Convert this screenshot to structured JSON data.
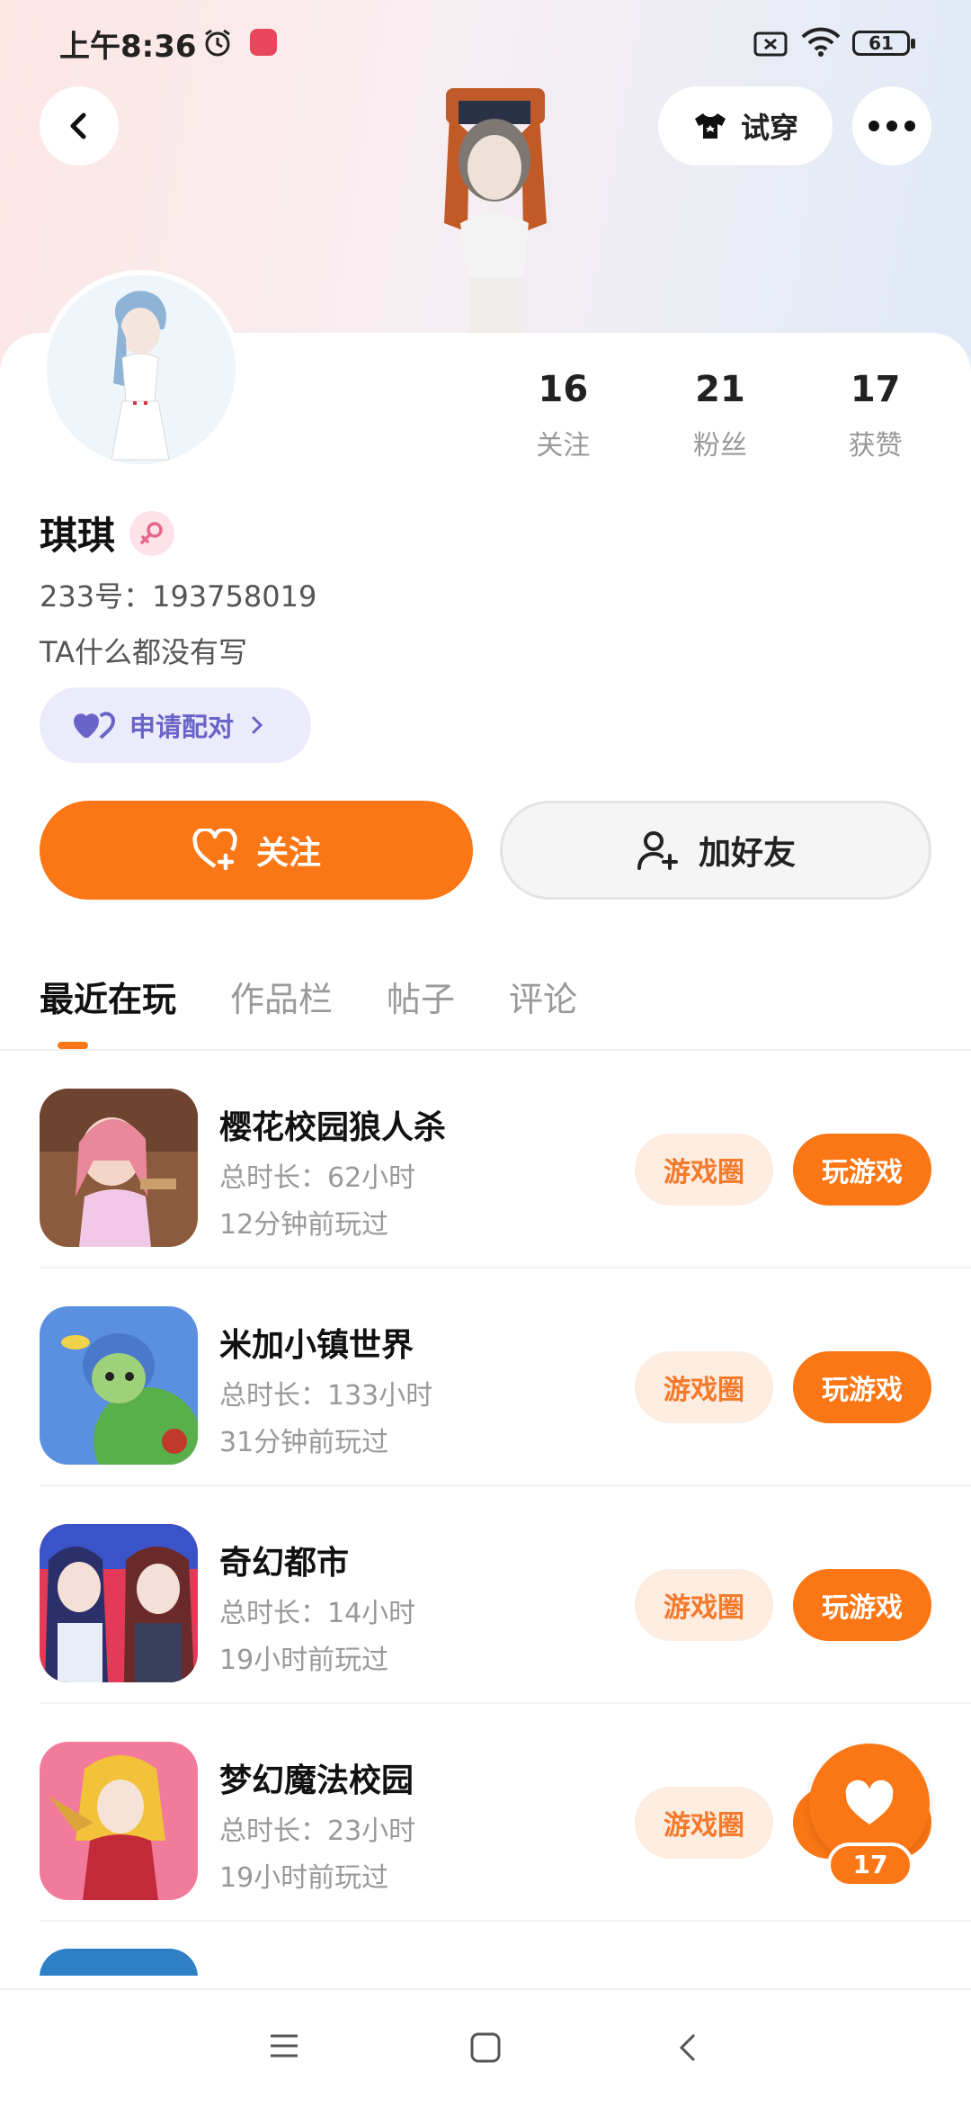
{
  "status_bar": {
    "time": "上午8:36",
    "battery": "61"
  },
  "header": {
    "tryon_label": "试穿"
  },
  "profile": {
    "name": "琪琪",
    "user_id": "233号：193758019",
    "bio": "TA什么都没有写",
    "stats": [
      {
        "value": "16",
        "label": "关注"
      },
      {
        "value": "21",
        "label": "粉丝"
      },
      {
        "value": "17",
        "label": "获赞"
      }
    ],
    "pair_label": "申请配对",
    "follow_label": "关注",
    "add_friend_label": "加好友"
  },
  "tabs": [
    {
      "label": "最近在玩",
      "active": true
    },
    {
      "label": "作品栏",
      "active": false
    },
    {
      "label": "帖子",
      "active": false
    },
    {
      "label": "评论",
      "active": false
    }
  ],
  "games": [
    {
      "name": "樱花校园狼人杀",
      "total_time": "总时长：62小时",
      "last_played": "12分钟前玩过",
      "circle_label": "游戏圈",
      "play_label": "玩游戏"
    },
    {
      "name": "米加小镇世界",
      "total_time": "总时长：133小时",
      "last_played": "31分钟前玩过",
      "circle_label": "游戏圈",
      "play_label": "玩游戏"
    },
    {
      "name": "奇幻都市",
      "total_time": "总时长：14小时",
      "last_played": "19小时前玩过",
      "circle_label": "游戏圈",
      "play_label": "玩游戏"
    },
    {
      "name": "梦幻魔法校园",
      "total_time": "总时长：23小时",
      "last_played": "19小时前玩过",
      "circle_label": "游戏圈",
      "play_label": "玩游戏"
    }
  ],
  "like_fab": {
    "count": "17"
  },
  "colors": {
    "accent": "#fb7614",
    "accent_light": "#fdece0",
    "pair_bg": "#ecebfb",
    "pair_text": "#6b64c8"
  }
}
